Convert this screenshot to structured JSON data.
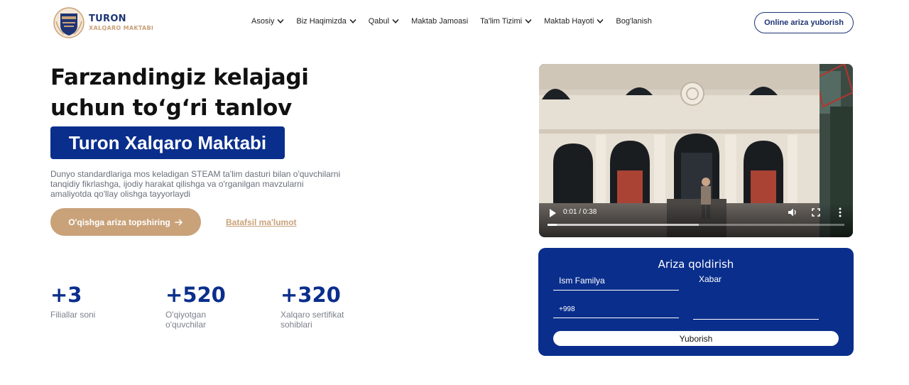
{
  "header": {
    "logo_title": "TURON",
    "logo_subtitle": "XALQARO MAKTABI",
    "nav": [
      {
        "label": "Asosiy",
        "dropdown": true
      },
      {
        "label": "Biz Haqimizda",
        "dropdown": true
      },
      {
        "label": "Qabul",
        "dropdown": true
      },
      {
        "label": "Maktab Jamoasi",
        "dropdown": false
      },
      {
        "label": "Ta'lim Tizimi",
        "dropdown": true
      },
      {
        "label": "Maktab Hayoti",
        "dropdown": true
      },
      {
        "label": "Bog'lanish",
        "dropdown": false
      }
    ],
    "cta_label": "Online ariza yuborish"
  },
  "hero": {
    "title_line1": "Farzandingiz kelajagi",
    "title_line2": "uchun to‘g‘ri tanlov",
    "badge": "Turon Xalqaro Maktabi",
    "description": "Dunyo standardlariga mos keladigan STEAM ta'lim dasturi bilan o'quvchilarni tanqidiy fikrlashga, ijodiy harakat qilishga va o'rganilgan mavzularni amaliyotda qo'llay olishga tayyorlaydi",
    "primary_button": "O'qishga ariza topshiring",
    "secondary_link": "Batafsil ma'lumot"
  },
  "stats": [
    {
      "value": "+3",
      "label": "Filiallar soni"
    },
    {
      "value": "+520",
      "label": "O'qiyotgan o'quvchilar"
    },
    {
      "value": "+320",
      "label": "Xalqaro sertifikat sohiblari"
    }
  ],
  "video": {
    "time_display": "0:01 / 0:38",
    "played_fraction": 0.03,
    "buffered_fraction": 0.51
  },
  "form": {
    "title": "Ariza qoldirish",
    "name_placeholder": "Ism Familya",
    "message_placeholder": "Xabar",
    "phone_value": "+998",
    "submit_label": "Yuborish"
  },
  "colors": {
    "brand_blue": "#0a2e8c",
    "accent_gold": "#c9a27a"
  }
}
